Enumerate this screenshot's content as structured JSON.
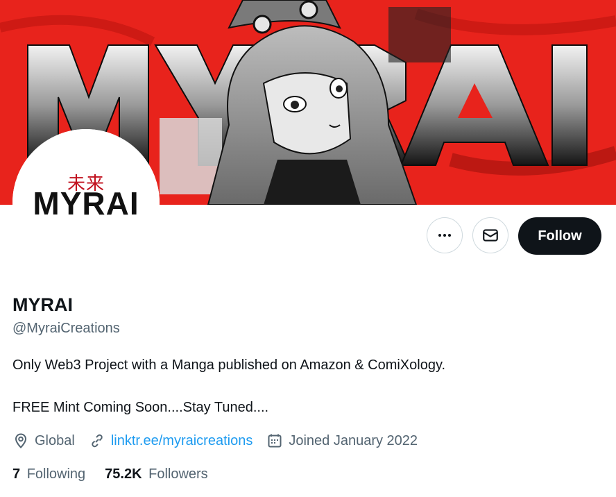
{
  "banner": {
    "wordmark": "MYRAI",
    "accent_color": "#e8231c"
  },
  "avatar": {
    "kanji": "未来",
    "wordmark": "MYRAI"
  },
  "actions": {
    "more_icon": "more-horizontal-icon",
    "message_icon": "mail-icon",
    "follow_label": "Follow"
  },
  "profile": {
    "name": "MYRAI",
    "handle": "@MyraiCreations",
    "bio_line1": "Only Web3 Project with a Manga published on Amazon & ComiXology.",
    "bio_line2": "FREE Mint Coming Soon....Stay Tuned...."
  },
  "meta": {
    "location_icon": "location-pin-icon",
    "location": "Global",
    "link_icon": "link-icon",
    "link": "linktr.ee/myraicreations",
    "joined_icon": "calendar-icon",
    "joined": "Joined January 2022"
  },
  "stats": {
    "following_count": "7",
    "following_label": "Following",
    "followers_count": "75.2K",
    "followers_label": "Followers"
  },
  "colors": {
    "link": "#1d9bf0",
    "secondary_text": "#536471",
    "primary_text": "#0f1419",
    "follow_button": "#0f1419"
  }
}
